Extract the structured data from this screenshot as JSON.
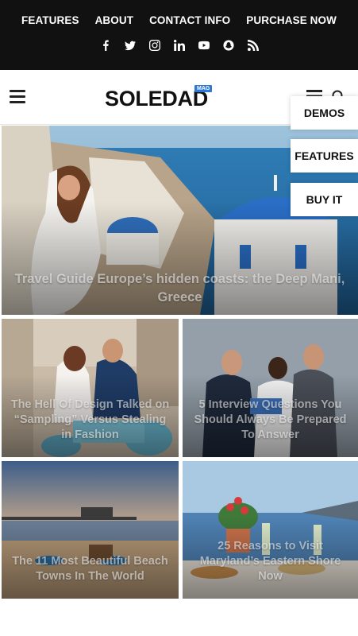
{
  "top_nav": [
    "FEATURES",
    "ABOUT",
    "CONTACT INFO",
    "PURCHASE NOW"
  ],
  "social_icons": [
    "facebook-icon",
    "twitter-icon",
    "instagram-icon",
    "linkedin-icon",
    "youtube-icon",
    "snapchat-icon",
    "rss-icon"
  ],
  "header": {
    "logo_text": "SOLEDAD",
    "logo_badge": "MAG"
  },
  "side_buttons": {
    "demos": "DEMOS",
    "features": "FEATURES",
    "buy": "BUY IT"
  },
  "posts": [
    {
      "title": "Travel Guide Europe’s hidden coasts: the Deep Mani, Greece"
    },
    {
      "title": "The Hell Of Design Talked on “Sampling” Versus Stealing in Fashion"
    },
    {
      "title": "5 Interview Questions You Should Always Be Prepared To Answer"
    },
    {
      "title": "The 11 Most Beautiful Beach Towns In The World"
    },
    {
      "title": "25 Reasons to Visit Maryland’s Eastern Shore Now"
    }
  ],
  "colors": {
    "topbar": "#111111",
    "badge": "#2f78d6"
  }
}
